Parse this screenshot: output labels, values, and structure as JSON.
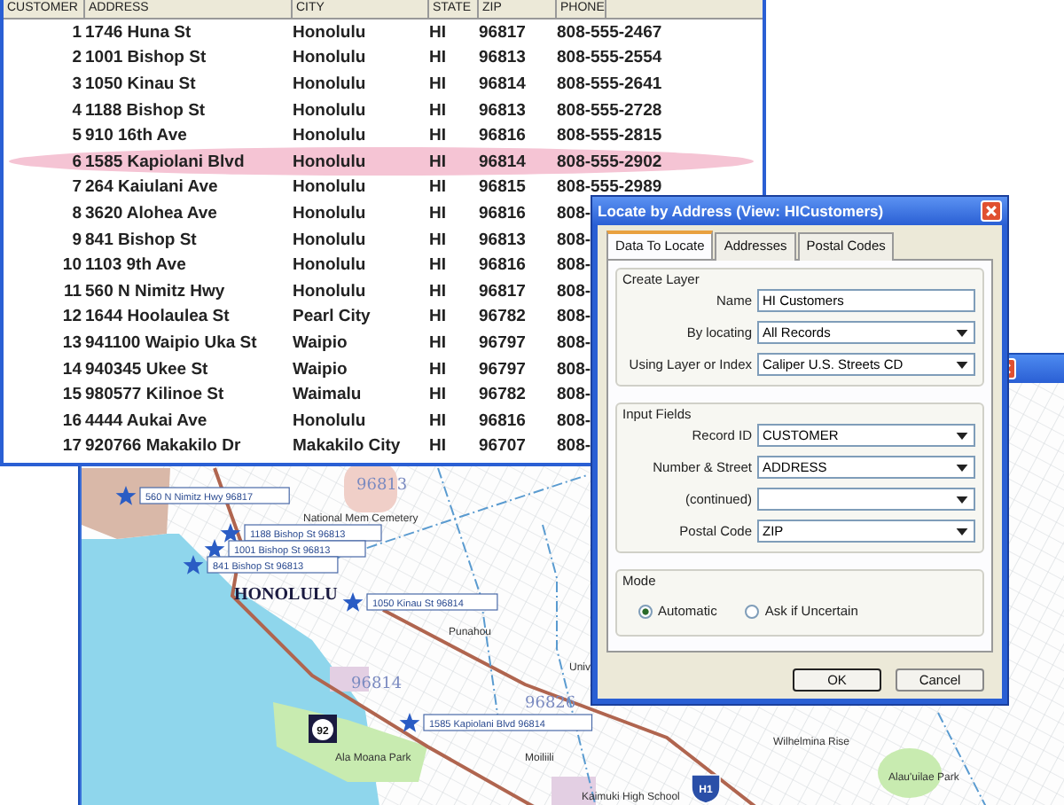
{
  "table_window": {
    "columns": [
      "CUSTOMER",
      "ADDRESS",
      "CITY",
      "STATE",
      "ZIP",
      "PHONE"
    ],
    "rows": [
      {
        "id": "1",
        "address": "1746 Huna St",
        "city": "Honolulu",
        "state": "HI",
        "zip": "96817",
        "phone": "808-555-2467",
        "highlighted": false
      },
      {
        "id": "2",
        "address": "1001 Bishop St",
        "city": "Honolulu",
        "state": "HI",
        "zip": "96813",
        "phone": "808-555-2554",
        "highlighted": false
      },
      {
        "id": "3",
        "address": "1050 Kinau St",
        "city": "Honolulu",
        "state": "HI",
        "zip": "96814",
        "phone": "808-555-2641",
        "highlighted": false
      },
      {
        "id": "4",
        "address": "1188 Bishop St",
        "city": "Honolulu",
        "state": "HI",
        "zip": "96813",
        "phone": "808-555-2728",
        "highlighted": false
      },
      {
        "id": "5",
        "address": "910 16th Ave",
        "city": "Honolulu",
        "state": "HI",
        "zip": "96816",
        "phone": "808-555-2815",
        "highlighted": false
      },
      {
        "id": "6",
        "address": "1585 Kapiolani Blvd",
        "city": "Honolulu",
        "state": "HI",
        "zip": "96814",
        "phone": "808-555-2902",
        "highlighted": true
      },
      {
        "id": "7",
        "address": "264 Kaiulani Ave",
        "city": "Honolulu",
        "state": "HI",
        "zip": "96815",
        "phone": "808-555-2989",
        "highlighted": false
      },
      {
        "id": "8",
        "address": "3620 Alohea Ave",
        "city": "Honolulu",
        "state": "HI",
        "zip": "96816",
        "phone": "808-",
        "highlighted": false
      },
      {
        "id": "9",
        "address": "841 Bishop St",
        "city": "Honolulu",
        "state": "HI",
        "zip": "96813",
        "phone": "808-",
        "highlighted": false
      },
      {
        "id": "10",
        "address": "1103 9th Ave",
        "city": "Honolulu",
        "state": "HI",
        "zip": "96816",
        "phone": "808-",
        "highlighted": false
      },
      {
        "id": "11",
        "address": "560 N Nimitz Hwy",
        "city": "Honolulu",
        "state": "HI",
        "zip": "96817",
        "phone": "808-",
        "highlighted": false
      },
      {
        "id": "12",
        "address": "1644 Hoolaulea St",
        "city": "Pearl City",
        "state": "HI",
        "zip": "96782",
        "phone": "808-",
        "highlighted": false
      },
      {
        "id": "13",
        "address": "941100 Waipio Uka St",
        "city": "Waipio",
        "state": "HI",
        "zip": "96797",
        "phone": "808-",
        "highlighted": false
      },
      {
        "id": "14",
        "address": "940345 Ukee St",
        "city": "Waipio",
        "state": "HI",
        "zip": "96797",
        "phone": "808-",
        "highlighted": false
      },
      {
        "id": "15",
        "address": "980577 Kilinoe St",
        "city": "Waimalu",
        "state": "HI",
        "zip": "96782",
        "phone": "808-",
        "highlighted": false
      },
      {
        "id": "16",
        "address": "4444 Aukai Ave",
        "city": "Honolulu",
        "state": "HI",
        "zip": "96816",
        "phone": "808-",
        "highlighted": false
      },
      {
        "id": "17",
        "address": "920766 Makakilo Dr",
        "city": "Makakilo City",
        "state": "HI",
        "zip": "96707",
        "phone": "808-",
        "highlighted": false
      }
    ]
  },
  "map_window": {
    "map": {
      "markers": [
        {
          "label": "560 N Nimitz Hwy 96817"
        },
        {
          "label": "1188 Bishop St 96813"
        },
        {
          "label": "1001 Bishop St 96813"
        },
        {
          "label": "841 Bishop St 96813"
        },
        {
          "label": "1050 Kinau St 96814"
        },
        {
          "label": "1585 Kapiolani Blvd 96814"
        }
      ],
      "city_label": "HONOLULU",
      "zip_labels": [
        "96813",
        "96814",
        "96826"
      ],
      "place_labels": [
        "National Mem Cemetery",
        "Punahou",
        "Univ",
        "Moiliili",
        "Wilhelmina Rise",
        "Alau'uilae Park",
        "Kaimuki High School",
        "Ala Moana Park"
      ],
      "route_shields": [
        {
          "label": "92",
          "kind": "state"
        },
        {
          "label": "H1",
          "kind": "interstate"
        }
      ]
    }
  },
  "dialog": {
    "title": "Locate by Address (View: HICustomers)",
    "tabs": [
      {
        "label": "Data To Locate",
        "selected": true
      },
      {
        "label": "Addresses",
        "selected": false
      },
      {
        "label": "Postal Codes",
        "selected": false
      }
    ],
    "groups": [
      {
        "title": "Create Layer",
        "fields": [
          {
            "label": "Name",
            "kind": "text",
            "value": "HI Customers"
          },
          {
            "label": "By locating",
            "kind": "dropdown",
            "value": "All Records"
          },
          {
            "label": "Using Layer or Index",
            "kind": "dropdown",
            "value": "Caliper U.S. Streets CD"
          }
        ]
      },
      {
        "title": "Input Fields",
        "fields": [
          {
            "label": "Record ID",
            "kind": "dropdown",
            "value": "CUSTOMER"
          },
          {
            "label": "Number & Street",
            "kind": "dropdown",
            "value": "ADDRESS"
          },
          {
            "label": "(continued)",
            "kind": "dropdown"
          },
          {
            "label": "Postal Code",
            "kind": "dropdown",
            "value": "ZIP"
          }
        ]
      }
    ],
    "mode": {
      "title": "Mode",
      "options": [
        {
          "label": "Automatic",
          "selected": true
        },
        {
          "label": "Ask if Uncertain",
          "selected": false
        }
      ]
    },
    "buttons": [
      {
        "label": "OK",
        "default": true
      },
      {
        "label": "Cancel",
        "default": false
      }
    ]
  }
}
